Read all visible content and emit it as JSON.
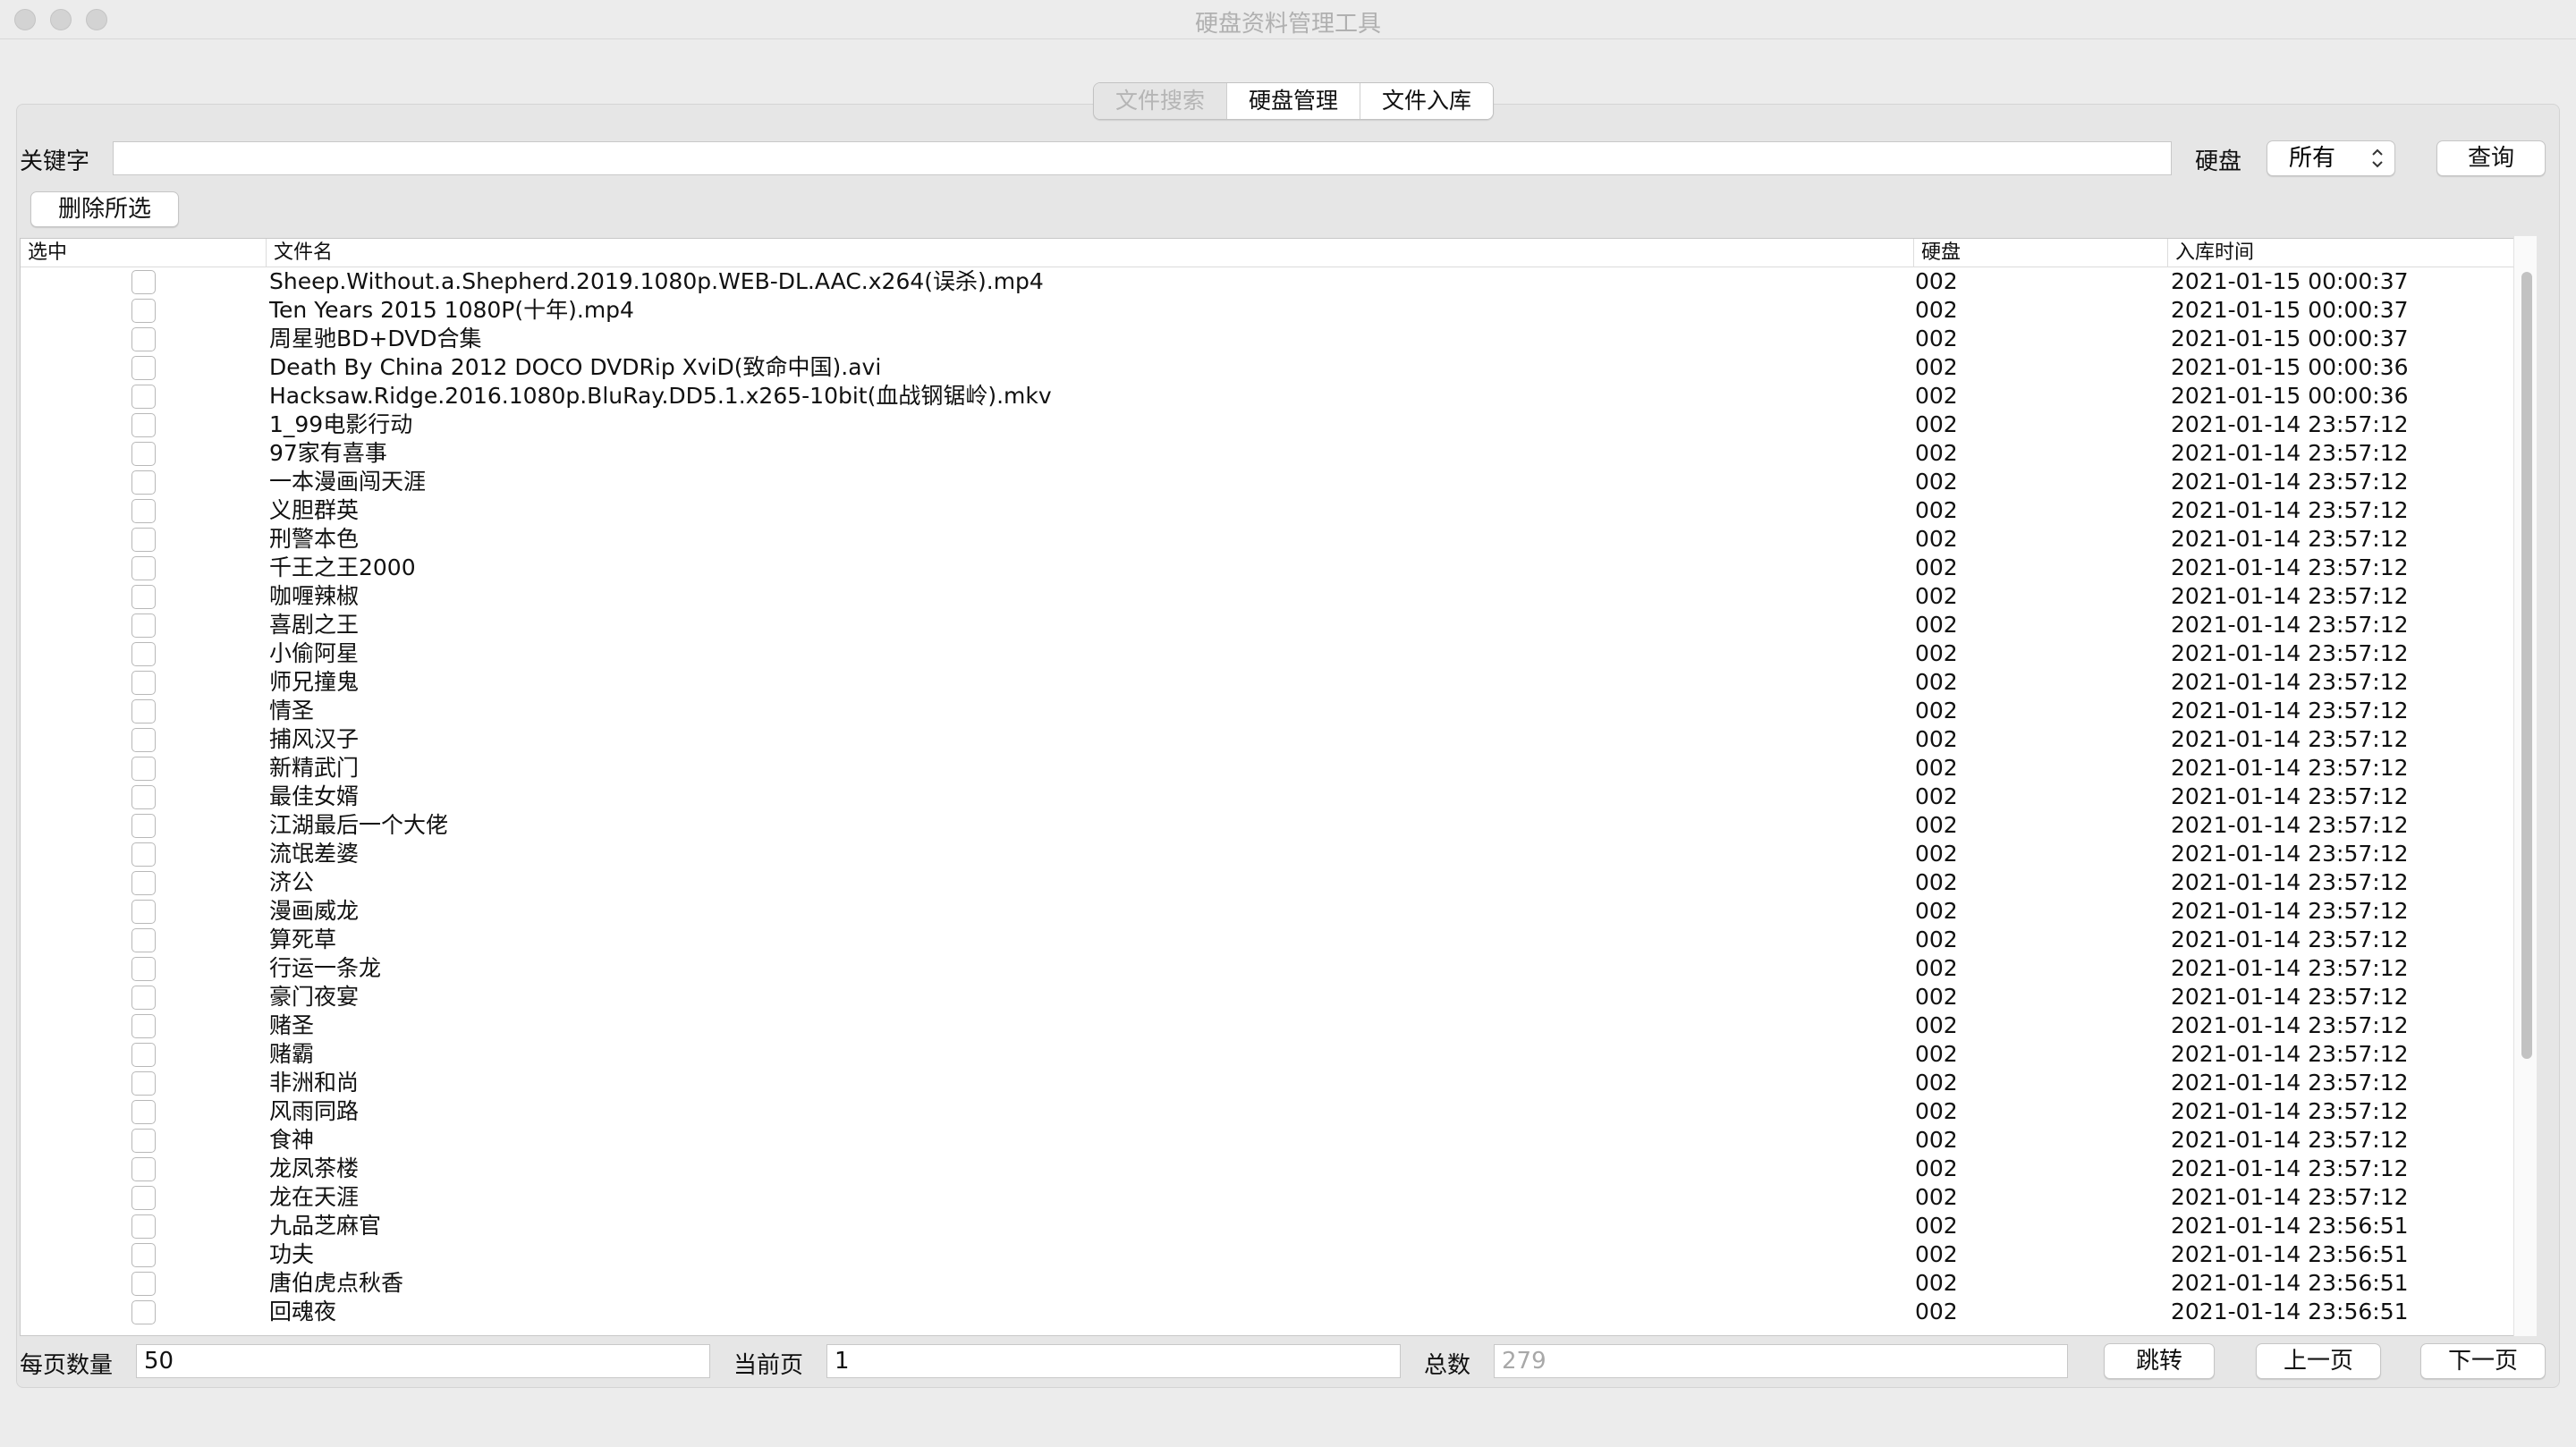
{
  "window": {
    "title": "硬盘资料管理工具"
  },
  "tabs": [
    {
      "label": "文件搜索",
      "selected": true
    },
    {
      "label": "硬盘管理",
      "selected": false
    },
    {
      "label": "文件入库",
      "selected": false
    }
  ],
  "search": {
    "keyword_label": "关键字",
    "keyword_value": "",
    "disk_label": "硬盘",
    "disk_selected": "所有",
    "query_button": "查询"
  },
  "toolbar": {
    "delete_selected_button": "删除所选"
  },
  "table": {
    "columns": [
      "选中",
      "文件名",
      "硬盘",
      "入库时间"
    ],
    "rows": [
      {
        "checked": false,
        "name": "Sheep.Without.a.Shepherd.2019.1080p.WEB-DL.AAC.x264(误杀).mp4",
        "disk": "002",
        "time": "2021-01-15 00:00:37"
      },
      {
        "checked": false,
        "name": "Ten Years 2015 1080P(十年).mp4",
        "disk": "002",
        "time": "2021-01-15 00:00:37"
      },
      {
        "checked": false,
        "name": "周星驰BD+DVD合集",
        "disk": "002",
        "time": "2021-01-15 00:00:37"
      },
      {
        "checked": false,
        "name": "Death By China 2012 DOCO DVDRip XviD(致命中国).avi",
        "disk": "002",
        "time": "2021-01-15 00:00:36"
      },
      {
        "checked": false,
        "name": "Hacksaw.Ridge.2016.1080p.BluRay.DD5.1.x265-10bit(血战钢锯岭).mkv",
        "disk": "002",
        "time": "2021-01-15 00:00:36"
      },
      {
        "checked": false,
        "name": "1_99电影行动",
        "disk": "002",
        "time": "2021-01-14 23:57:12"
      },
      {
        "checked": false,
        "name": "97家有喜事",
        "disk": "002",
        "time": "2021-01-14 23:57:12"
      },
      {
        "checked": false,
        "name": "一本漫画闯天涯",
        "disk": "002",
        "time": "2021-01-14 23:57:12"
      },
      {
        "checked": false,
        "name": "义胆群英",
        "disk": "002",
        "time": "2021-01-14 23:57:12"
      },
      {
        "checked": false,
        "name": "刑警本色",
        "disk": "002",
        "time": "2021-01-14 23:57:12"
      },
      {
        "checked": false,
        "name": "千王之王2000",
        "disk": "002",
        "time": "2021-01-14 23:57:12"
      },
      {
        "checked": false,
        "name": "咖喱辣椒",
        "disk": "002",
        "time": "2021-01-14 23:57:12"
      },
      {
        "checked": false,
        "name": "喜剧之王",
        "disk": "002",
        "time": "2021-01-14 23:57:12"
      },
      {
        "checked": false,
        "name": "小偷阿星",
        "disk": "002",
        "time": "2021-01-14 23:57:12"
      },
      {
        "checked": false,
        "name": "师兄撞鬼",
        "disk": "002",
        "time": "2021-01-14 23:57:12"
      },
      {
        "checked": false,
        "name": "情圣",
        "disk": "002",
        "time": "2021-01-14 23:57:12"
      },
      {
        "checked": false,
        "name": "捕风汉子",
        "disk": "002",
        "time": "2021-01-14 23:57:12"
      },
      {
        "checked": false,
        "name": "新精武门",
        "disk": "002",
        "time": "2021-01-14 23:57:12"
      },
      {
        "checked": false,
        "name": "最佳女婿",
        "disk": "002",
        "time": "2021-01-14 23:57:12"
      },
      {
        "checked": false,
        "name": "江湖最后一个大佬",
        "disk": "002",
        "time": "2021-01-14 23:57:12"
      },
      {
        "checked": false,
        "name": "流氓差婆",
        "disk": "002",
        "time": "2021-01-14 23:57:12"
      },
      {
        "checked": false,
        "name": "济公",
        "disk": "002",
        "time": "2021-01-14 23:57:12"
      },
      {
        "checked": false,
        "name": "漫画威龙",
        "disk": "002",
        "time": "2021-01-14 23:57:12"
      },
      {
        "checked": false,
        "name": "算死草",
        "disk": "002",
        "time": "2021-01-14 23:57:12"
      },
      {
        "checked": false,
        "name": "行运一条龙",
        "disk": "002",
        "time": "2021-01-14 23:57:12"
      },
      {
        "checked": false,
        "name": "豪门夜宴",
        "disk": "002",
        "time": "2021-01-14 23:57:12"
      },
      {
        "checked": false,
        "name": "赌圣",
        "disk": "002",
        "time": "2021-01-14 23:57:12"
      },
      {
        "checked": false,
        "name": "赌霸",
        "disk": "002",
        "time": "2021-01-14 23:57:12"
      },
      {
        "checked": false,
        "name": "非洲和尚",
        "disk": "002",
        "time": "2021-01-14 23:57:12"
      },
      {
        "checked": false,
        "name": "风雨同路",
        "disk": "002",
        "time": "2021-01-14 23:57:12"
      },
      {
        "checked": false,
        "name": "食神",
        "disk": "002",
        "time": "2021-01-14 23:57:12"
      },
      {
        "checked": false,
        "name": "龙凤茶楼",
        "disk": "002",
        "time": "2021-01-14 23:57:12"
      },
      {
        "checked": false,
        "name": "龙在天涯",
        "disk": "002",
        "time": "2021-01-14 23:57:12"
      },
      {
        "checked": false,
        "name": "九品芝麻官",
        "disk": "002",
        "time": "2021-01-14 23:56:51"
      },
      {
        "checked": false,
        "name": "功夫",
        "disk": "002",
        "time": "2021-01-14 23:56:51"
      },
      {
        "checked": false,
        "name": "唐伯虎点秋香",
        "disk": "002",
        "time": "2021-01-14 23:56:51"
      },
      {
        "checked": false,
        "name": "回魂夜",
        "disk": "002",
        "time": "2021-01-14 23:56:51"
      }
    ]
  },
  "pagination": {
    "per_page_label": "每页数量",
    "per_page_value": "50",
    "current_page_label": "当前页",
    "current_page_value": "1",
    "total_label": "总数",
    "total_value": "279",
    "jump_button": "跳转",
    "prev_button": "上一页",
    "next_button": "下一页"
  },
  "icons": {
    "select_arrows": "up-down-chevron-icon",
    "window_controls": [
      "close-icon",
      "minimize-icon",
      "zoom-icon"
    ]
  },
  "colors": {
    "window_bg": "#ececec",
    "panel_bg": "#e6e6e6",
    "selected_tab_text": "#b5b5b5"
  }
}
